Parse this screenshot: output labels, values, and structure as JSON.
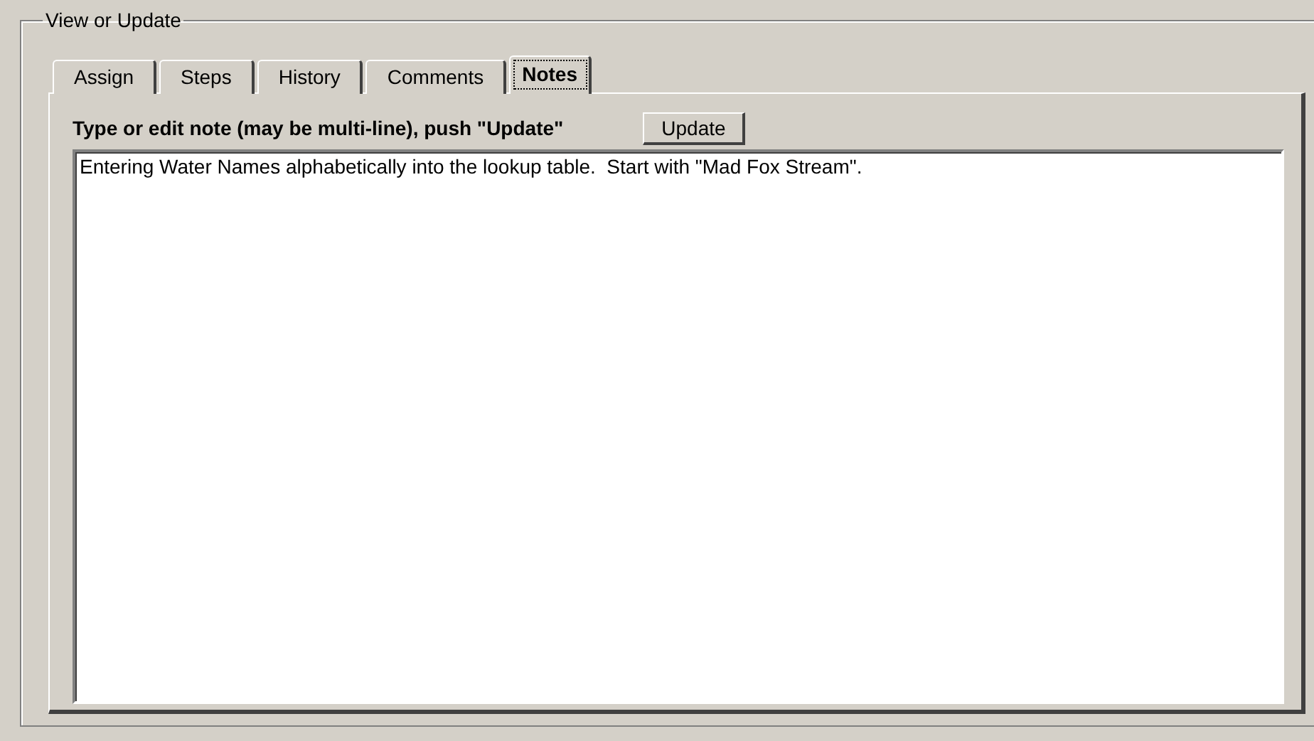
{
  "group": {
    "title": "View or Update"
  },
  "tabs": [
    {
      "label": "Assign",
      "selected": false
    },
    {
      "label": "Steps",
      "selected": false
    },
    {
      "label": "History",
      "selected": false
    },
    {
      "label": "Comments",
      "selected": false
    },
    {
      "label": "Notes",
      "selected": true
    }
  ],
  "instruction": "Type or edit note (may be multi-line), push \"Update\"",
  "update_button": "Update",
  "note": {
    "value": "Entering Water Names alphabetically into the lookup table.  Start with \"Mad Fox Stream\"."
  }
}
